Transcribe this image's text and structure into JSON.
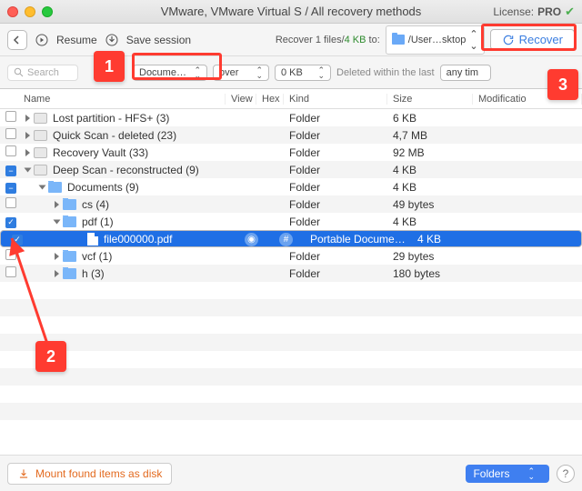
{
  "title": "VMware, VMware Virtual S / All recovery methods",
  "license": {
    "label": "License:",
    "level": "PRO"
  },
  "toolbar": {
    "resume": "Resume",
    "save": "Save session",
    "recover_info_prefix": "Recover 1 files/",
    "recover_info_size": "4 KB",
    "recover_info_suffix": " to:",
    "path": "/User…sktop",
    "recover": "Recover"
  },
  "filterbar": {
    "search_placeholder": "Search",
    "filter1": "Docume…",
    "filter2": "over",
    "filter3": "0 KB",
    "deleted_label": "Deleted within the last",
    "deleted_value": "any tim"
  },
  "columns": {
    "name": "Name",
    "view": "View",
    "hex": "Hex",
    "kind": "Kind",
    "size": "Size",
    "mod": "Modificatio"
  },
  "rows": [
    {
      "chk": "",
      "disc": "closed",
      "depth": 0,
      "icon": "drive",
      "label": "Lost partition - HFS+ (3)",
      "kind": "Folder",
      "size": "6 KB",
      "stripe": false
    },
    {
      "chk": "",
      "disc": "closed",
      "depth": 0,
      "icon": "drive",
      "label": "Quick Scan - deleted (23)",
      "kind": "Folder",
      "size": "4,7 MB",
      "stripe": true
    },
    {
      "chk": "",
      "disc": "closed",
      "depth": 0,
      "icon": "drive",
      "label": "Recovery Vault (33)",
      "kind": "Folder",
      "size": "92 MB",
      "stripe": false
    },
    {
      "chk": "partial",
      "disc": "open",
      "depth": 0,
      "icon": "drive",
      "label": "Deep Scan - reconstructed (9)",
      "kind": "Folder",
      "size": "4 KB",
      "stripe": true
    },
    {
      "chk": "partial",
      "disc": "open",
      "depth": 1,
      "icon": "folder",
      "label": "Documents (9)",
      "kind": "Folder",
      "size": "4 KB",
      "stripe": false
    },
    {
      "chk": "",
      "disc": "closed",
      "depth": 2,
      "icon": "folder",
      "label": "cs (4)",
      "kind": "Folder",
      "size": "49 bytes",
      "stripe": true
    },
    {
      "chk": "checked",
      "disc": "open",
      "depth": 2,
      "icon": "folder",
      "label": "pdf (1)",
      "kind": "Folder",
      "size": "4 KB",
      "stripe": false
    },
    {
      "chk": "checked",
      "disc": "",
      "depth": 3,
      "icon": "file",
      "label": "file000000.pdf",
      "kind": "Portable Docume…",
      "size": "4 KB",
      "stripe": true,
      "selected": true,
      "preview": true
    },
    {
      "chk": "",
      "disc": "closed",
      "depth": 2,
      "icon": "folder",
      "label": "vcf (1)",
      "kind": "Folder",
      "size": "29 bytes",
      "stripe": false
    },
    {
      "chk": "",
      "disc": "closed",
      "depth": 2,
      "icon": "folder",
      "label": "h (3)",
      "kind": "Folder",
      "size": "180 bytes",
      "stripe": true
    }
  ],
  "footer": {
    "mount": "Mount found items as disk",
    "view_select": "Folders"
  },
  "callouts": {
    "c1": "1",
    "c2": "2",
    "c3": "3"
  }
}
